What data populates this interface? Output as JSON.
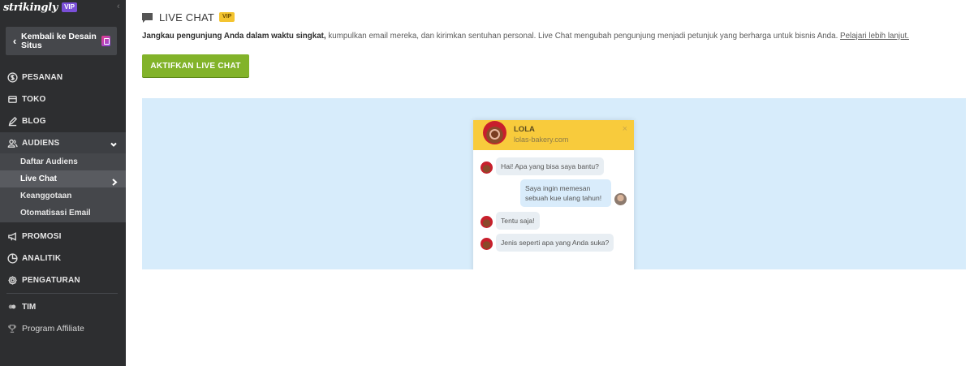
{
  "brand": {
    "logo": "strikingly",
    "vip": "VIP"
  },
  "sidebar": {
    "back_label": "Kembali ke Desain Situs",
    "items": [
      {
        "label": "PESANAN",
        "icon": "dollar-circle-icon"
      },
      {
        "label": "TOKO",
        "icon": "store-icon"
      },
      {
        "label": "BLOG",
        "icon": "pen-icon"
      },
      {
        "label": "AUDIENS",
        "icon": "users-icon"
      },
      {
        "label": "PROMOSI",
        "icon": "megaphone-icon"
      },
      {
        "label": "ANALITIK",
        "icon": "chart-icon"
      },
      {
        "label": "PENGATURAN",
        "icon": "gear-icon"
      }
    ],
    "audiens_sub": [
      {
        "label": "Daftar Audiens"
      },
      {
        "label": "Live Chat"
      },
      {
        "label": "Keanggotaan"
      },
      {
        "label": "Otomatisasi Email"
      }
    ],
    "team": "TIM",
    "affiliate": "Program Affiliate"
  },
  "main": {
    "title": "LIVE CHAT",
    "vip": "VIP",
    "desc_bold": "Jangkau pengunjung Anda dalam waktu singkat,",
    "desc_text": " kumpulkan email mereka, dan kirimkan sentuhan personal. Live Chat mengubah pengunjung menjadi petunjuk yang berharga untuk bisnis Anda. ",
    "desc_link": "Pelajari lebih lanjut.",
    "cta": "AKTIFKAN LIVE CHAT"
  },
  "widget": {
    "name": "LOLA",
    "site": "lolas-bakery.com",
    "close": "×",
    "messages": [
      {
        "from": "bot",
        "text": "Hai! Apa yang bisa saya bantu?"
      },
      {
        "from": "user",
        "text": "Saya ingin memesan sebuah kue ulang tahun!"
      },
      {
        "from": "bot",
        "text": "Tentu saja!"
      },
      {
        "from": "bot",
        "text": "Jenis seperti apa yang Anda suka?"
      }
    ]
  },
  "colors": {
    "sidebar_bg": "#2d2e30",
    "cta_green": "#82b32a",
    "vip_purple": "#7a4fd8",
    "vip_yellow": "#f4c430",
    "preview_bg": "#d7ecfb",
    "widget_header": "#f8cb3c"
  }
}
